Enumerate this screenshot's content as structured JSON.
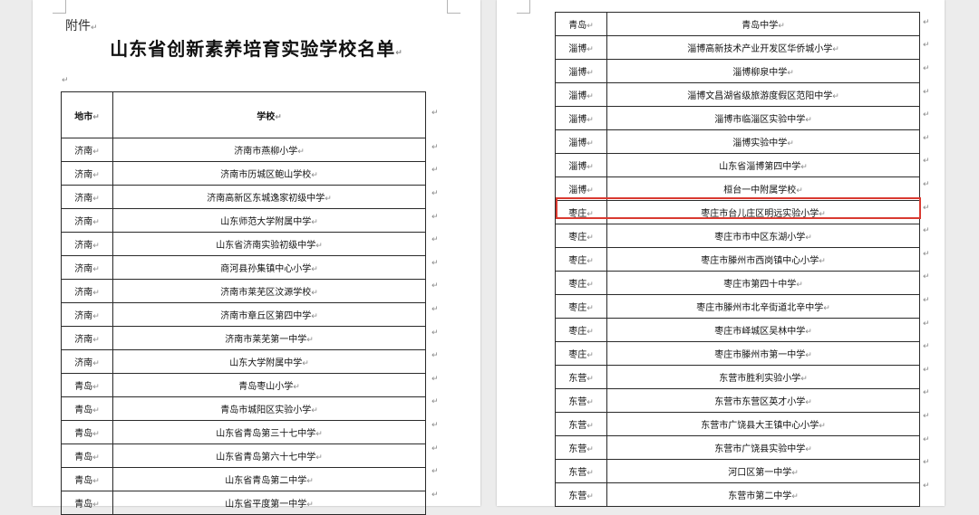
{
  "left_page": {
    "prefix": "附件",
    "title": "山东省创新素养培育实验学校名单",
    "header": {
      "city": "地市",
      "school": "学校"
    },
    "rows": [
      {
        "city": "济南",
        "school": "济南市燕柳小学"
      },
      {
        "city": "济南",
        "school": "济南市历城区鲍山学校"
      },
      {
        "city": "济南",
        "school": "济南高新区东城逸家初级中学"
      },
      {
        "city": "济南",
        "school": "山东师范大学附属中学"
      },
      {
        "city": "济南",
        "school": "山东省济南实验初级中学"
      },
      {
        "city": "济南",
        "school": "商河县孙集镇中心小学"
      },
      {
        "city": "济南",
        "school": "济南市莱芜区汶源学校"
      },
      {
        "city": "济南",
        "school": "济南市章丘区第四中学"
      },
      {
        "city": "济南",
        "school": "济南市莱芜第一中学"
      },
      {
        "city": "济南",
        "school": "山东大学附属中学"
      },
      {
        "city": "青岛",
        "school": "青岛枣山小学"
      },
      {
        "city": "青岛",
        "school": "青岛市城阳区实验小学"
      },
      {
        "city": "青岛",
        "school": "山东省青岛第三十七中学"
      },
      {
        "city": "青岛",
        "school": "山东省青岛第六十七中学"
      },
      {
        "city": "青岛",
        "school": "山东省青岛第二中学"
      },
      {
        "city": "青岛",
        "school": "山东省平度第一中学"
      }
    ]
  },
  "right_page": {
    "rows": [
      {
        "city": "青岛",
        "school": "青岛中学"
      },
      {
        "city": "淄博",
        "school": "淄博高新技术产业开发区华侨城小学"
      },
      {
        "city": "淄博",
        "school": "淄博柳泉中学"
      },
      {
        "city": "淄博",
        "school": "淄博文昌湖省级旅游度假区范阳中学"
      },
      {
        "city": "淄博",
        "school": "淄博市临淄区实验中学"
      },
      {
        "city": "淄博",
        "school": "淄博实验中学"
      },
      {
        "city": "淄博",
        "school": "山东省淄博第四中学"
      },
      {
        "city": "淄博",
        "school": "桓台一中附属学校"
      },
      {
        "city": "枣庄",
        "school": "枣庄市台儿庄区明远实验小学"
      },
      {
        "city": "枣庄",
        "school": "枣庄市市中区东湖小学"
      },
      {
        "city": "枣庄",
        "school": "枣庄市滕州市西岗镇中心小学"
      },
      {
        "city": "枣庄",
        "school": "枣庄市第四十中学"
      },
      {
        "city": "枣庄",
        "school": "枣庄市滕州市北辛街道北辛中学"
      },
      {
        "city": "枣庄",
        "school": "枣庄市峄城区吴林中学"
      },
      {
        "city": "枣庄",
        "school": "枣庄市滕州市第一中学"
      },
      {
        "city": "东营",
        "school": "东营市胜利实验小学"
      },
      {
        "city": "东营",
        "school": "东营市东营区英才小学"
      },
      {
        "city": "东营",
        "school": "东营市广饶县大王镇中心小学"
      },
      {
        "city": "东营",
        "school": "东营市广饶县实验中学"
      },
      {
        "city": "东营",
        "school": "河口区第一中学"
      },
      {
        "city": "东营",
        "school": "东营市第二中学"
      }
    ],
    "highlighted_row_index": 8
  },
  "paragraph_mark": "↵",
  "colors": {
    "highlight": "#d93a31",
    "spellcheck": "#3b52c4"
  }
}
